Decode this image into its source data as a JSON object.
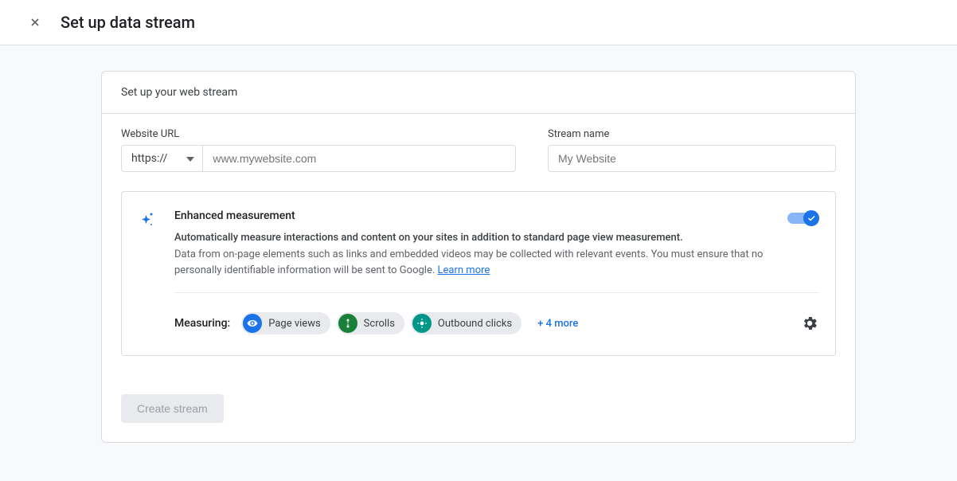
{
  "header": {
    "title": "Set up data stream"
  },
  "card": {
    "heading": "Set up your web stream"
  },
  "fields": {
    "url_label": "Website URL",
    "url_scheme": "https://",
    "url_placeholder": "www.mywebsite.com",
    "name_label": "Stream name",
    "name_placeholder": "My Website"
  },
  "enhanced": {
    "title": "Enhanced measurement",
    "subtitle": "Automatically measure interactions and content on your sites in addition to standard page view measurement.",
    "description": "Data from on-page elements such as links and embedded videos may be collected with relevant events. You must ensure that no personally identifiable information will be sent to Google.",
    "learn_more": "Learn more",
    "toggle_on": true
  },
  "measuring": {
    "label": "Measuring:",
    "chips": [
      {
        "label": "Page views",
        "color": "blue",
        "icon": "eye"
      },
      {
        "label": "Scrolls",
        "color": "green",
        "icon": "scroll"
      },
      {
        "label": "Outbound clicks",
        "color": "teal",
        "icon": "click"
      }
    ],
    "more": "+ 4 more"
  },
  "footer": {
    "create_label": "Create stream"
  }
}
